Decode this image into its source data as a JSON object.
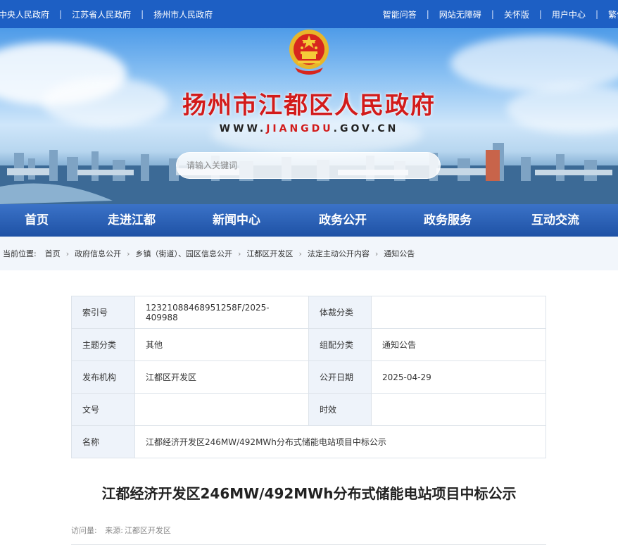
{
  "topbar": {
    "left_links": [
      "中央人民政府",
      "江苏省人民政府",
      "扬州市人民政府"
    ],
    "right_links": [
      "智能问答",
      "网站无障碍",
      "关怀版",
      "用户中心",
      "繁体"
    ]
  },
  "banner": {
    "title": "扬州市江都区人民政府",
    "url_prefix": "WWW.",
    "url_accent": "JIANGDU",
    "url_suffix": ".GOV.CN",
    "search_placeholder": "请输入关键词"
  },
  "nav": [
    "首页",
    "走进江都",
    "新闻中心",
    "政务公开",
    "政务服务",
    "互动交流"
  ],
  "breadcrumb": {
    "label": "当前位置:",
    "items": [
      "首页",
      "政府信息公开",
      "乡镇（街道）、园区信息公开",
      "江都区开发区",
      "法定主动公开内容",
      "通知公告"
    ]
  },
  "info": {
    "index_label": "索引号",
    "index_value": "12321088468951258F/2025-409988",
    "genre_label": "体裁分类",
    "genre_value": "",
    "topic_label": "主题分类",
    "topic_value": "其他",
    "group_label": "组配分类",
    "group_value": "通知公告",
    "org_label": "发布机构",
    "org_value": "江都区开发区",
    "date_label": "公开日期",
    "date_value": "2025-04-29",
    "docno_label": "文号",
    "docno_value": "",
    "validity_label": "时效",
    "validity_value": "",
    "name_label": "名称",
    "name_value": "江都经济开发区246MW/492MWh分布式储能电站项目中标公示"
  },
  "article": {
    "title": "江都经济开发区246MW/492MWh分布式储能电站项目中标公示",
    "views_label": "访问量:",
    "source_label": "来源:",
    "source_value": "江都区开发区"
  },
  "colors": {
    "topbar": "#1d5fc4",
    "title_red": "#d21b1b",
    "nav": "#1a52b0"
  }
}
